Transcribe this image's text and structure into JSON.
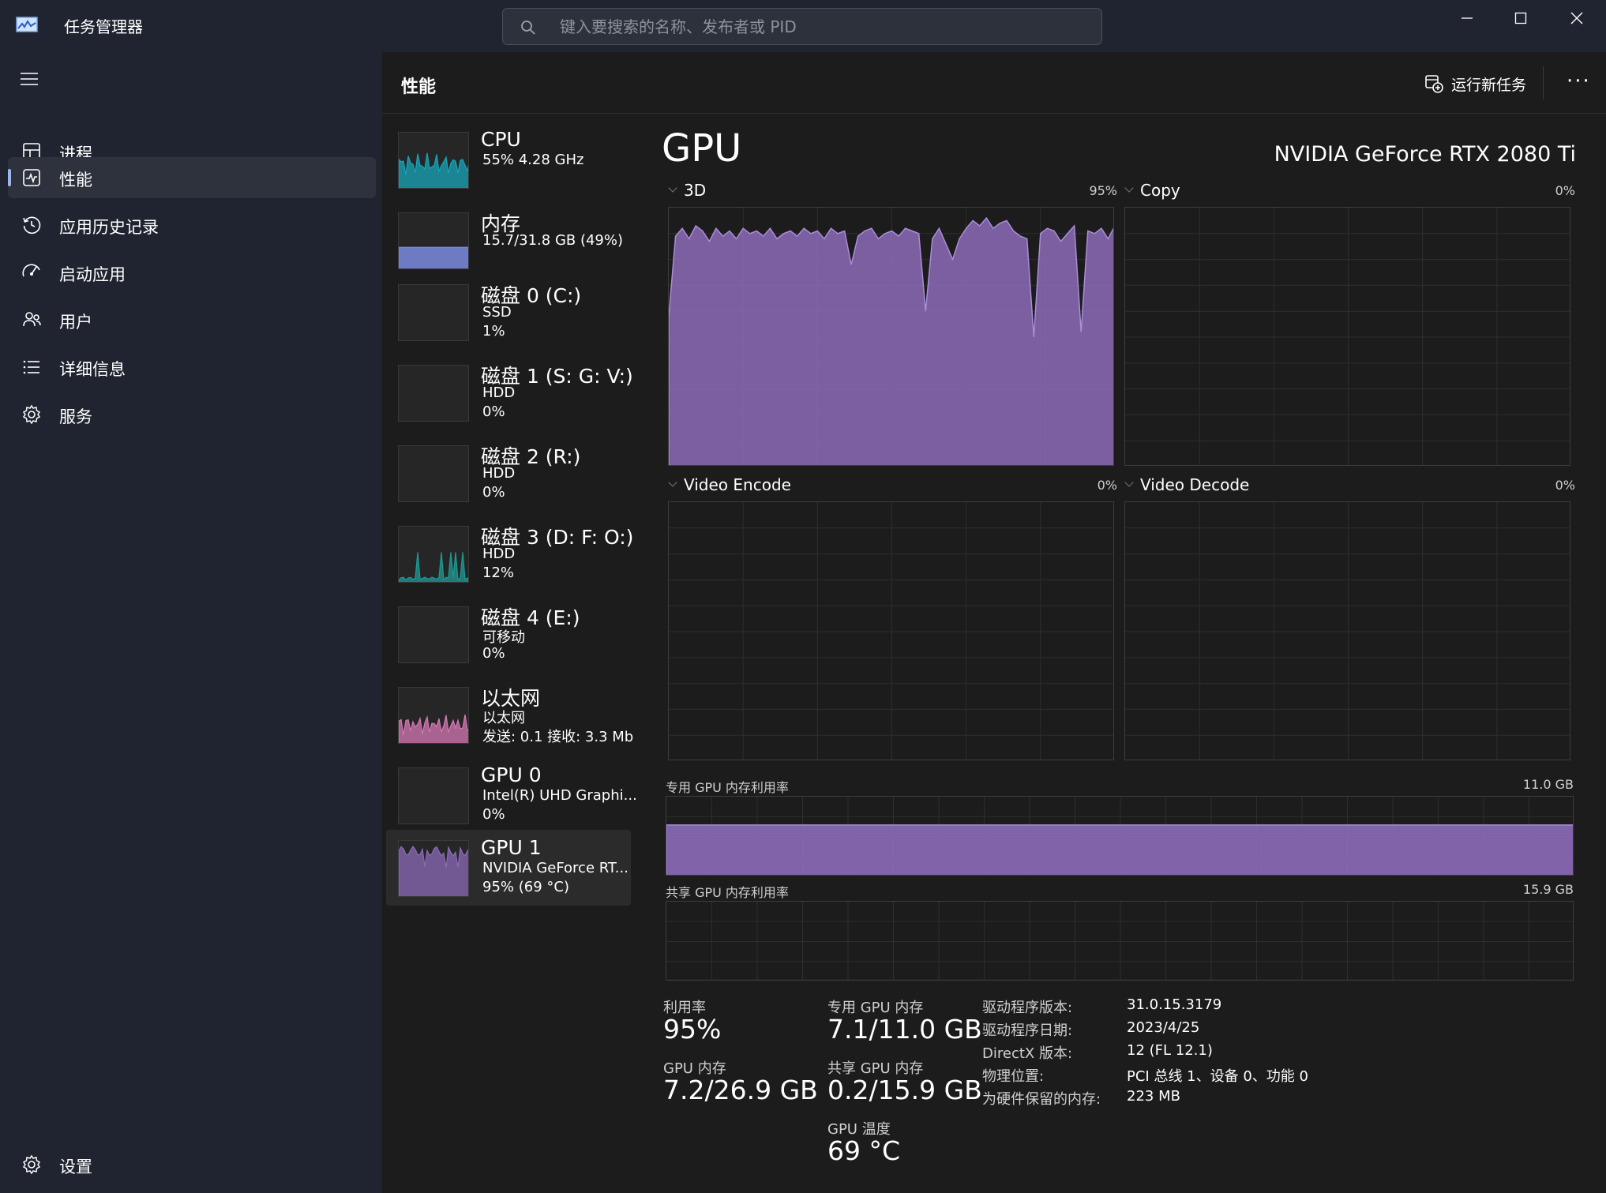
{
  "window": {
    "title": "任务管理器",
    "search_placeholder": "键入要搜索的名称、发布者或 PID"
  },
  "sidebar": {
    "items": [
      {
        "label": "进程",
        "icon": "processes-icon",
        "active": false
      },
      {
        "label": "性能",
        "icon": "performance-icon",
        "active": true
      },
      {
        "label": "应用历史记录",
        "icon": "history-icon",
        "active": false
      },
      {
        "label": "启动应用",
        "icon": "startup-icon",
        "active": false
      },
      {
        "label": "用户",
        "icon": "users-icon",
        "active": false
      },
      {
        "label": "详细信息",
        "icon": "details-icon",
        "active": false
      },
      {
        "label": "服务",
        "icon": "services-icon",
        "active": false
      }
    ],
    "settings_label": "设置"
  },
  "header": {
    "title": "性能",
    "run_task_label": "运行新任务",
    "more_label": "···"
  },
  "devices": [
    {
      "name": "CPU",
      "lines": [
        "55%  4.28 GHz"
      ],
      "selected": false,
      "color": "#18a6b9"
    },
    {
      "name": "内存",
      "lines": [
        "15.7/31.8 GB (49%)"
      ],
      "selected": false,
      "color": "#7a8be0"
    },
    {
      "name": "磁盘 0 (C:)",
      "lines": [
        "SSD",
        "1%"
      ],
      "selected": false,
      "color": "#2fa39a"
    },
    {
      "name": "磁盘 1 (S: G: V:)",
      "lines": [
        "HDD",
        "0%"
      ],
      "selected": false,
      "color": "#2fa39a"
    },
    {
      "name": "磁盘 2 (R:)",
      "lines": [
        "HDD",
        "0%"
      ],
      "selected": false,
      "color": "#2fa39a"
    },
    {
      "name": "磁盘 3 (D: F: O:)",
      "lines": [
        "HDD",
        "12%"
      ],
      "selected": false,
      "color": "#1e9a95"
    },
    {
      "name": "磁盘 4 (E:)",
      "lines": [
        "可移动",
        "0%"
      ],
      "selected": false,
      "color": "#2fa39a"
    },
    {
      "name": "以太网",
      "lines": [
        "以太网",
        "发送: 0.1  接收: 3.3 Mb"
      ],
      "selected": false,
      "color": "#d478b4"
    },
    {
      "name": "GPU 0",
      "lines": [
        "Intel(R) UHD Graphi...",
        "0%"
      ],
      "selected": false,
      "color": "#8c6bb8"
    },
    {
      "name": "GPU 1",
      "lines": [
        "NVIDIA GeForce RT...",
        "95% (69 °C)"
      ],
      "selected": true,
      "color": "#8c6bb8"
    }
  ],
  "gpu": {
    "title": "GPU",
    "model": "NVIDIA GeForce RTX 2080 Ti",
    "graphs": [
      {
        "label": "3D",
        "percent": "95%"
      },
      {
        "label": "Copy",
        "percent": "0%"
      },
      {
        "label": "Video Encode",
        "percent": "0%"
      },
      {
        "label": "Video Decode",
        "percent": "0%"
      }
    ],
    "dedicated_mem_label": "专用 GPU 内存利用率",
    "dedicated_mem_max": "11.0 GB",
    "shared_mem_label": "共享 GPU 内存利用率",
    "shared_mem_max": "15.9 GB",
    "dedicated_fill": 0.645,
    "shared_fill": 0.013,
    "color": "#8c6bb8",
    "stats": {
      "util_label": "利用率",
      "util_value": "95%",
      "dedicated_label": "专用 GPU 内存",
      "dedicated_value": "7.1/11.0 GB",
      "gpu_mem_label": "GPU 内存",
      "gpu_mem_value": "7.2/26.9 GB",
      "shared_label": "共享 GPU 内存",
      "shared_value": "0.2/15.9 GB",
      "temp_label": "GPU 温度",
      "temp_value": "69 °C"
    },
    "info": [
      {
        "key": "驱动程序版本:",
        "value": "31.0.15.3179"
      },
      {
        "key": "驱动程序日期:",
        "value": "2023/4/25"
      },
      {
        "key": "DirectX 版本:",
        "value": "12 (FL 12.1)"
      },
      {
        "key": "物理位置:",
        "value": "PCI 总线 1、设备 0、功能 0"
      },
      {
        "key": "为硬件保留的内存:",
        "value": "223 MB"
      }
    ],
    "history_3d": [
      58,
      89,
      92,
      88,
      93,
      91,
      87,
      92,
      89,
      91,
      88,
      92,
      90,
      91,
      89,
      92,
      88,
      90,
      91,
      89,
      92,
      90,
      91,
      88,
      92,
      90,
      91,
      78,
      89,
      91,
      92,
      88,
      90,
      91,
      89,
      92,
      91,
      90,
      60,
      88,
      92,
      86,
      80,
      88,
      92,
      95,
      93,
      96,
      92,
      94,
      95,
      91,
      89,
      88,
      50,
      90,
      92,
      91,
      87,
      90,
      93,
      52,
      91,
      90,
      92,
      88,
      93
    ]
  }
}
